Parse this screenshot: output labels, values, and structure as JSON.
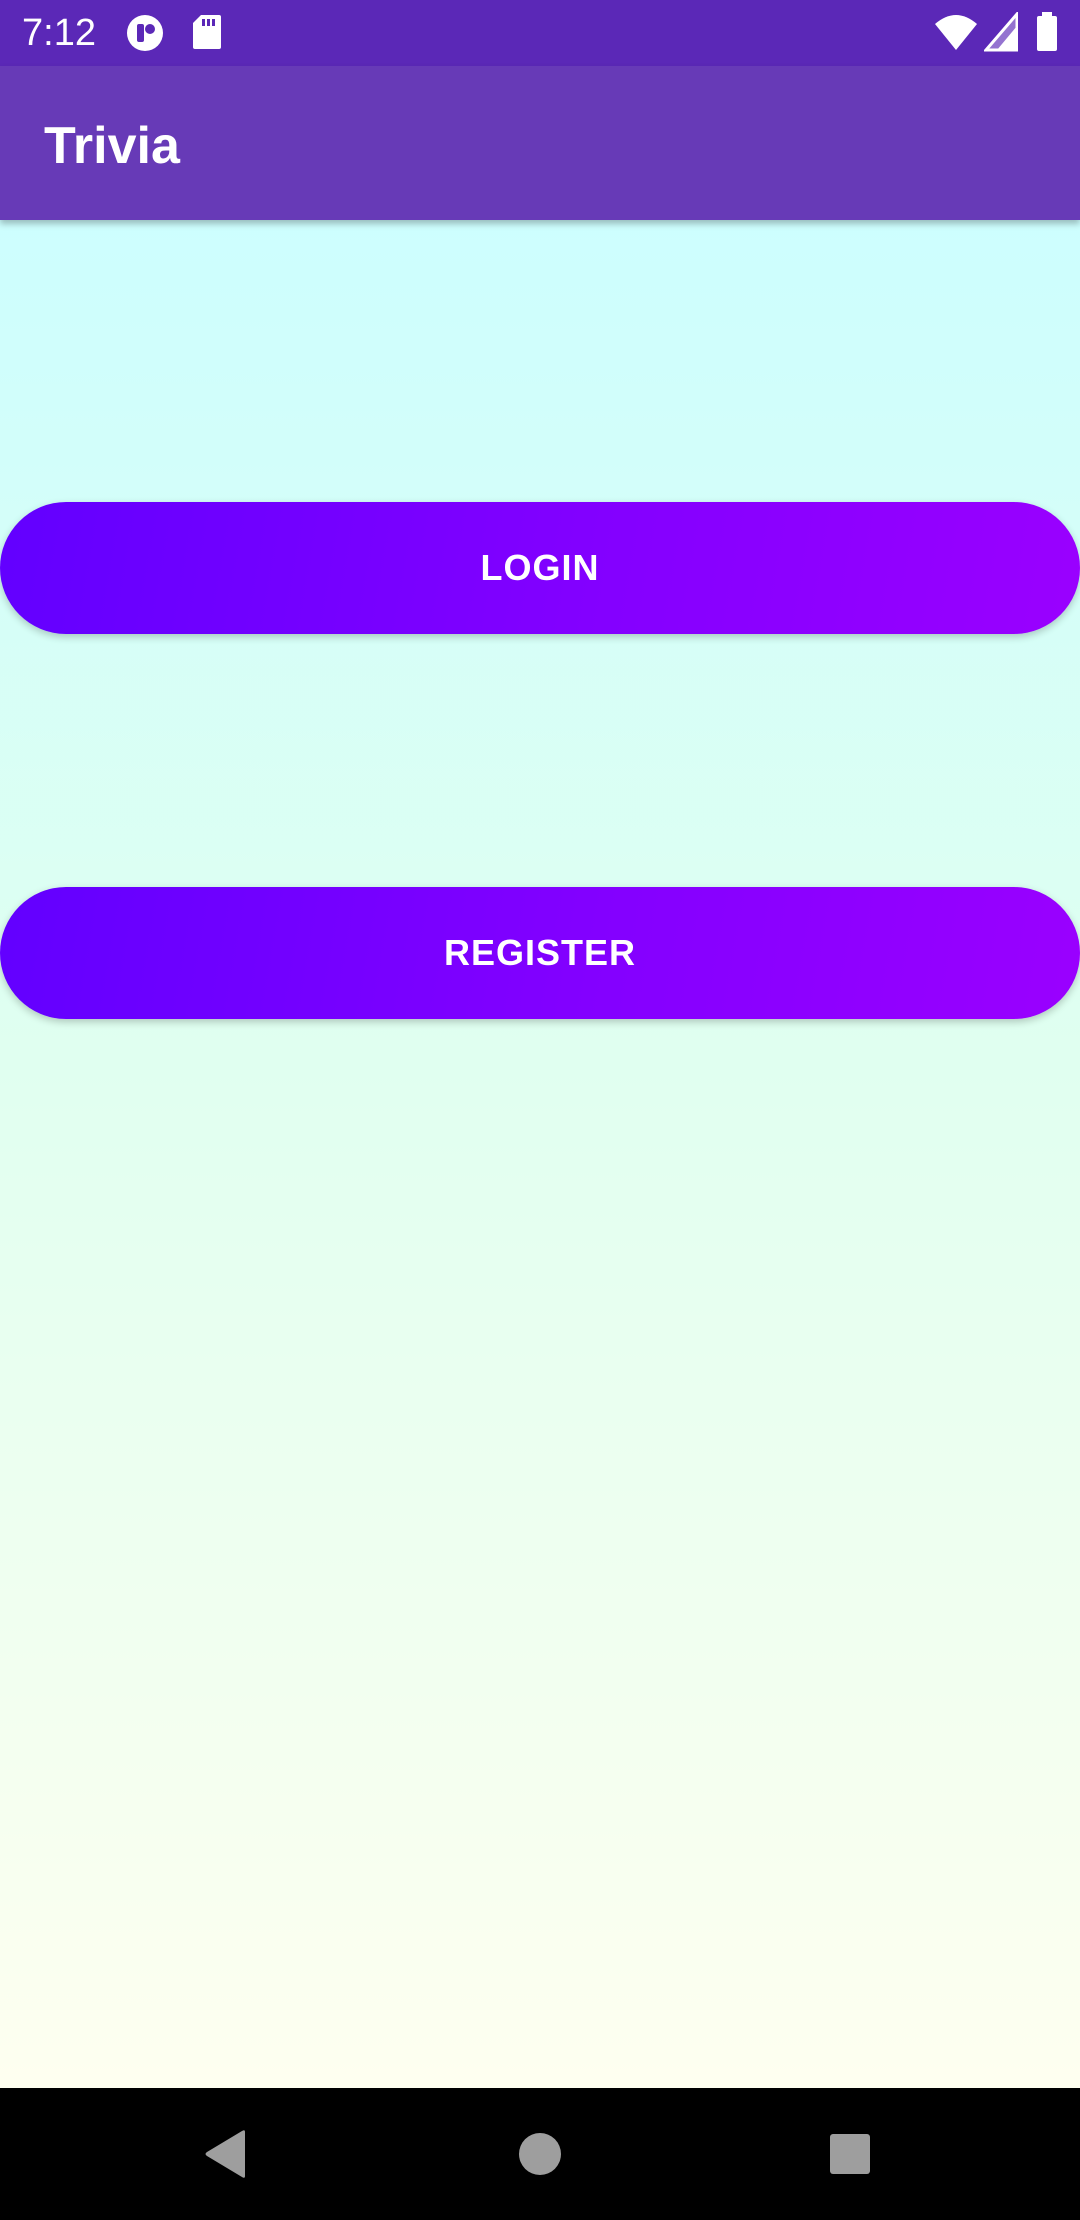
{
  "status_bar": {
    "time": "7:12",
    "left_icons": [
      "notification-app-icon",
      "sd-card-icon"
    ],
    "right_icons": [
      "wifi-icon",
      "cell-signal-icon",
      "battery-icon"
    ]
  },
  "app_bar": {
    "title": "Trivia"
  },
  "main": {
    "login_label": "LOGIN",
    "register_label": "REGISTER"
  },
  "nav_bar": {
    "icons": [
      "back-icon",
      "home-icon",
      "recents-icon"
    ]
  },
  "colors": {
    "status_bar": "#5b28b7",
    "app_bar": "#673ab7",
    "button_gradient_start": "#6200ff",
    "button_gradient_end": "#9a00ff",
    "background_top": "#cdfefe",
    "background_bottom": "#fefff0"
  }
}
